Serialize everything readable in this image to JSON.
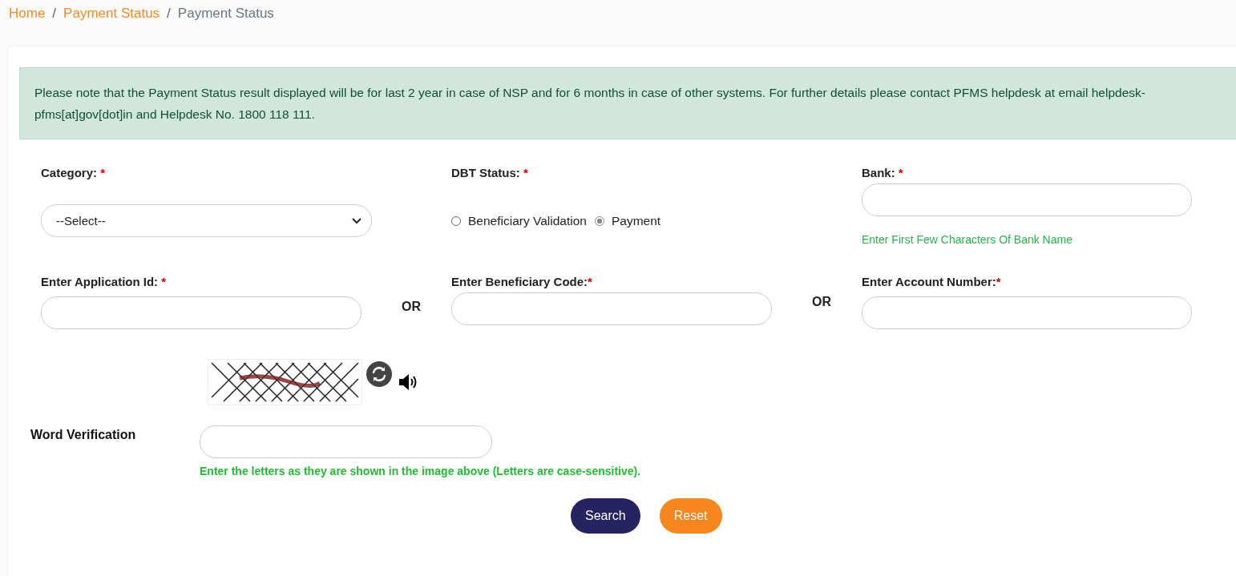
{
  "breadcrumb": [
    {
      "label": "Home",
      "kind": "link"
    },
    {
      "label": "Payment Status",
      "kind": "link"
    },
    {
      "label": "Payment Status",
      "kind": "current"
    }
  ],
  "breadcrumb_separator": "/",
  "notice": "Please note that the Payment Status result displayed will be for last 2 year in case of NSP and for 6 months in case of other systems. For further details please contact PFMS helpdesk at email helpdesk-pfms[at]gov[dot]in and Helpdesk No. 1800 118 111.",
  "category": {
    "label": "Category:",
    "required": "*",
    "value": "--Select--"
  },
  "dbt_status": {
    "label": "DBT Status:",
    "required": "*",
    "options": [
      {
        "label": "Beneficiary Validation",
        "selected": false
      },
      {
        "label": "Payment",
        "selected": true
      }
    ]
  },
  "bank": {
    "label": "Bank:",
    "required": "*",
    "hint": "Enter First Few Characters Of Bank Name"
  },
  "application_id": {
    "label": "Enter Application Id:",
    "required": "*"
  },
  "beneficiary_code": {
    "label": "Enter Beneficiary Code:",
    "required": "*"
  },
  "account_number": {
    "label": "Enter Account Number:",
    "required": "*"
  },
  "or_labels": [
    "OR",
    "OR"
  ],
  "captcha": {
    "kind": "picture"
  },
  "word_verification": {
    "label": "Word Verification",
    "hint": "Enter the letters as they are shown in the image above (Letters are case-sensitive)."
  },
  "buttons": [
    {
      "label": "Search",
      "kind": "primary"
    },
    {
      "label": "Reset",
      "kind": "secondary"
    }
  ]
}
